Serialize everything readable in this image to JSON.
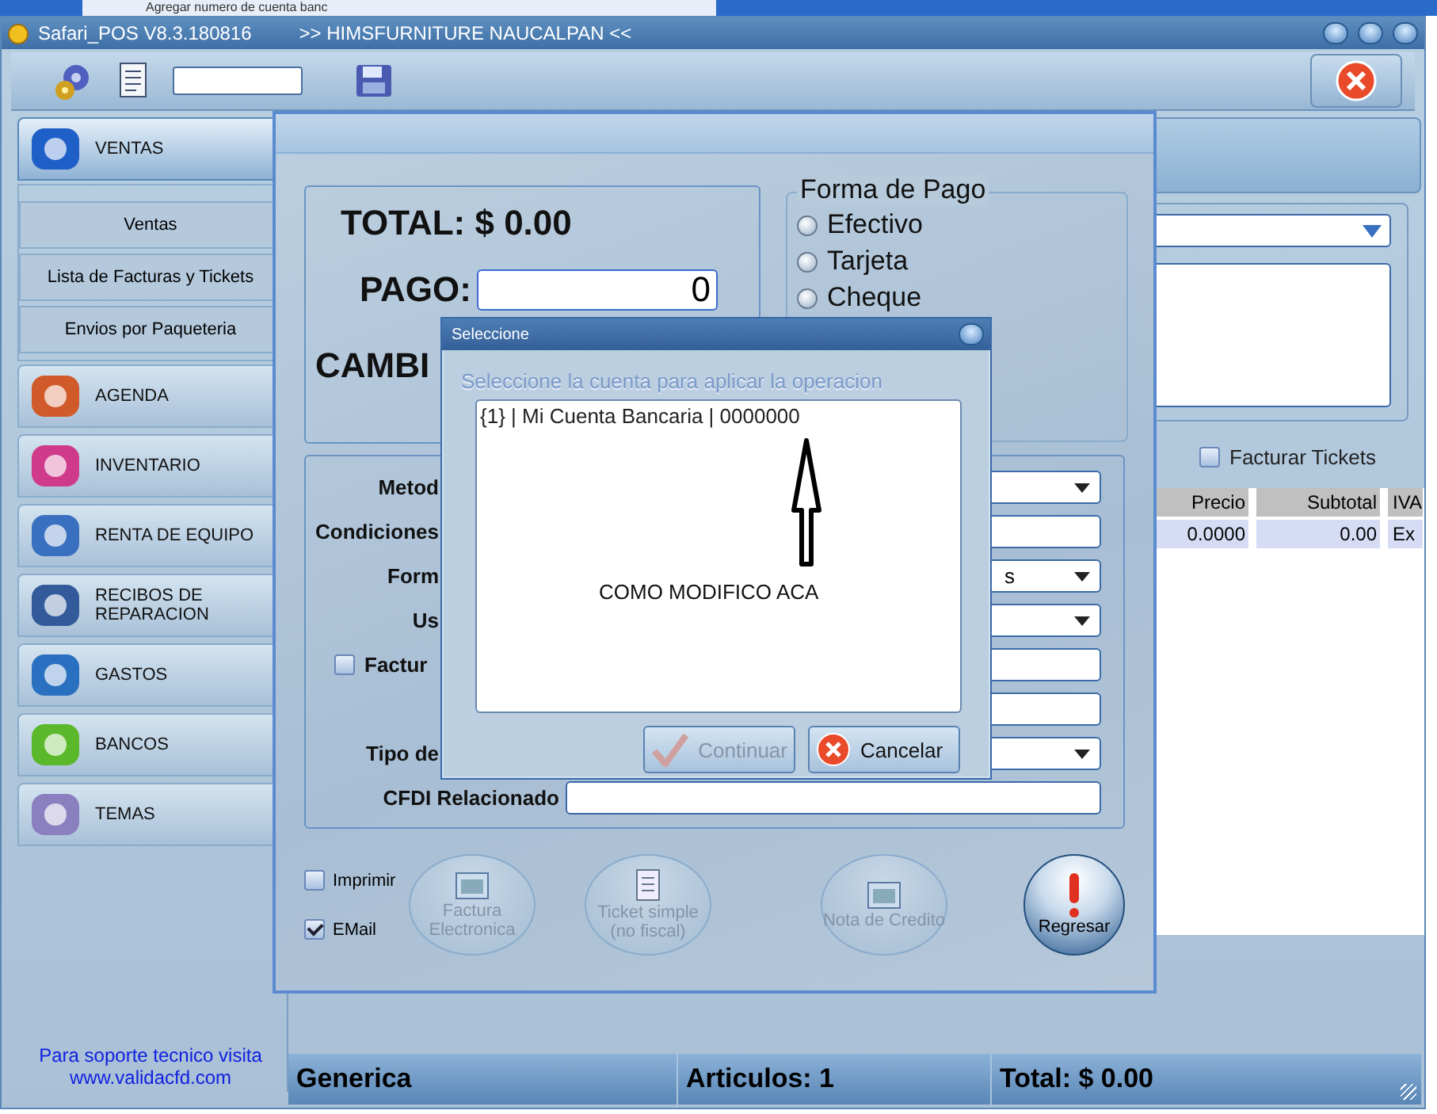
{
  "browser_tab": {
    "title": "Agregar numero de cuenta banc"
  },
  "window": {
    "title": "Safari_POS V8.3.180816",
    "subtitle": ">> HIMSFURNITURE  NAUCALPAN <<"
  },
  "sidebar": {
    "sections": [
      {
        "label": "VENTAS",
        "expanded": true,
        "items": [
          {
            "label": "Ventas"
          },
          {
            "label": "Lista de Facturas y Tickets"
          },
          {
            "label": "Envios por Paqueteria"
          }
        ]
      },
      {
        "label": "AGENDA",
        "expanded": false
      },
      {
        "label": "INVENTARIO",
        "expanded": false
      },
      {
        "label": "RENTA DE EQUIPO",
        "expanded": false
      },
      {
        "label": "RECIBOS DE REPARACION",
        "expanded": false
      },
      {
        "label": "GASTOS",
        "expanded": false
      },
      {
        "label": "BANCOS",
        "expanded": false
      },
      {
        "label": "TEMAS",
        "expanded": false
      }
    ],
    "footer": {
      "text": "Para soporte tecnico visita",
      "link": "www.validacfd.com"
    }
  },
  "main": {
    "facturar_tickets": {
      "label": "Facturar Tickets",
      "checked": false
    },
    "table": {
      "columns": [
        "Precio",
        "Subtotal",
        "IVA"
      ],
      "rows": [
        [
          "0.0000",
          "0.00",
          "Ex"
        ]
      ]
    }
  },
  "payment_dialog": {
    "total": "TOTAL: $ 0.00",
    "pago_label": "PAGO:",
    "pago_value": "0",
    "cambio_label": "CAMBI",
    "payment_method": {
      "title": "Forma de Pago",
      "options": [
        {
          "label": "Efectivo",
          "selected": false
        },
        {
          "label": "Tarjeta",
          "selected": false
        },
        {
          "label": "Cheque",
          "selected": false
        }
      ]
    },
    "fields": [
      {
        "kind": "select",
        "label": "Metod"
      },
      {
        "kind": "input",
        "label": "Condiciones"
      },
      {
        "kind": "select",
        "label": "Form",
        "value": "s"
      },
      {
        "kind": "select",
        "label": "Us"
      },
      {
        "kind": "checkbox",
        "label": "Factur",
        "checked": false
      },
      {
        "kind": "input"
      },
      {
        "kind": "select",
        "label": "Tipo de"
      },
      {
        "kind": "wide",
        "label": "CFDI Relacionado"
      }
    ],
    "options": [
      {
        "label": "Imprimir",
        "checked": false
      },
      {
        "label": "EMail",
        "checked": true
      }
    ],
    "buttons": [
      {
        "label": "Factura Electronica",
        "disabled": true
      },
      {
        "label": "Ticket simple (no fiscal)",
        "disabled": true
      },
      {
        "label": "Nota de Credito",
        "disabled": true
      },
      {
        "label": "Regresar",
        "disabled": false
      }
    ]
  },
  "select_dialog": {
    "title": "Seleccione",
    "prompt": "Seleccione la cuenta para aplicar la operacion",
    "items": [
      "{1} | Mi Cuenta Bancaria | 0000000"
    ],
    "annotation": "COMO MODIFICO ACA",
    "buttons": [
      {
        "label": "Continuar",
        "disabled": true
      },
      {
        "label": "Cancelar",
        "disabled": false
      }
    ]
  },
  "status_bar": [
    "Generica",
    "Articulos: 1",
    "Total: $ 0.00"
  ]
}
